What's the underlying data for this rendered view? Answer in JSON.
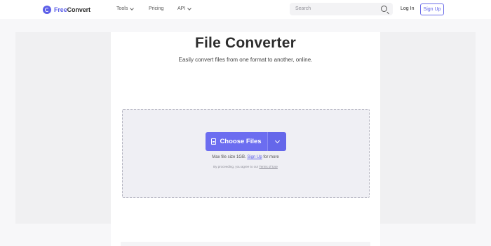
{
  "header": {
    "logo": {
      "part1": "Free",
      "part2": "Convert"
    },
    "nav": [
      {
        "label": "Tools",
        "has_dropdown": true
      },
      {
        "label": "Pricing",
        "has_dropdown": false
      },
      {
        "label": "API",
        "has_dropdown": true
      }
    ],
    "search": {
      "placeholder": "Search"
    },
    "login_label": "Log In",
    "signup_label": "Sign Up"
  },
  "hero": {
    "title": "File Converter",
    "subtitle": "Easily convert files from one format to another, online."
  },
  "upload": {
    "choose_label": "Choose Files",
    "max_prefix": "Max file size 1GB.",
    "max_link": "Sign Up",
    "max_suffix": "for more",
    "terms_prefix": "By proceeding, you agree to our",
    "terms_link": "Terms of Use"
  },
  "colors": {
    "brand": "#5c5fe8",
    "button": "#6c6df0",
    "dropzone": "#efeff4"
  }
}
